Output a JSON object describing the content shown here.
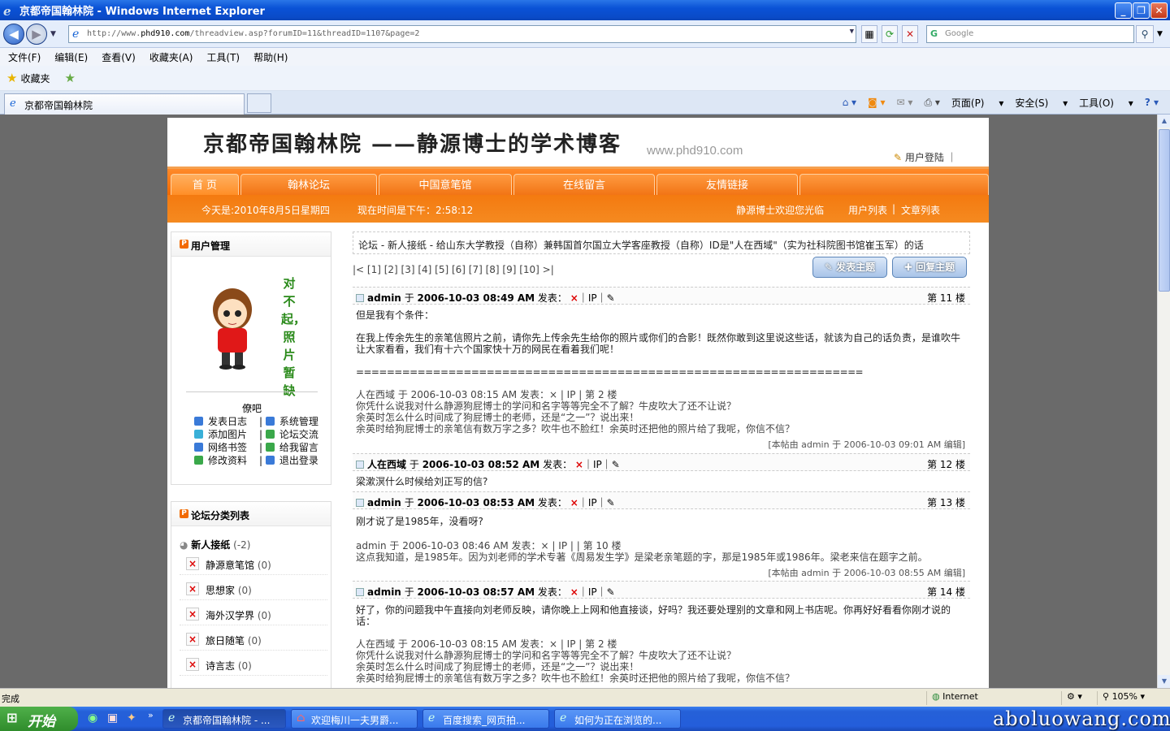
{
  "window": {
    "title": "京都帝国翰林院 - Windows Internet Explorer"
  },
  "address": {
    "url_prefix": "http://www.",
    "url_domain": "phd910.com",
    "url_path": "/threadview.asp?forumID=11&threadID=1107&page=2",
    "search_placeholder": "Google"
  },
  "menu": [
    "文件(F)",
    "编辑(E)",
    "查看(V)",
    "收藏夹(A)",
    "工具(T)",
    "帮助(H)"
  ],
  "favorites": {
    "label": "收藏夹"
  },
  "tab": {
    "title": "京都帝国翰林院"
  },
  "commandbar": {
    "page": "页面(P)",
    "safety": "安全(S)",
    "tools": "工具(O)"
  },
  "site": {
    "banner_title": "京都帝国翰林院 ——静源博士的学术博客",
    "banner_url": "www.phd910.com",
    "login": "用户登陆 ｜",
    "nav": [
      "首 页",
      "翰林论坛",
      "中国意笔馆",
      "在线留言",
      "友情链接"
    ],
    "date": "今天是:2010年8月5日星期四",
    "time": "现在时间是下午：2:58:12",
    "welcome": "静源博士欢迎您光临",
    "user_list": "用户列表",
    "article_list": "文章列表"
  },
  "sidebar": {
    "user_panel_title": "用户管理",
    "no_photo": "对不起，照片暂缺",
    "nickname": "僚吧",
    "links": [
      {
        "label": "发表日志",
        "color": "#3a7ad8"
      },
      {
        "label": "系统管理",
        "color": "#3a7ad8"
      },
      {
        "label": "添加图片",
        "color": "#3ab0d8"
      },
      {
        "label": "论坛交流",
        "color": "#3aa84a"
      },
      {
        "label": "网络书签",
        "color": "#3a7ad8"
      },
      {
        "label": "给我留言",
        "color": "#3aa84a"
      },
      {
        "label": "修改资料",
        "color": "#3aa84a"
      },
      {
        "label": "退出登录",
        "color": "#3a7ad8"
      }
    ],
    "forum_panel_title": "论坛分类列表",
    "forum_group": "新人接纸",
    "forum_group_count": "(-2)",
    "forums": [
      {
        "name": "静源意笔馆",
        "count": "(0)"
      },
      {
        "name": "思想家",
        "count": "(0)"
      },
      {
        "name": "海外汉学界",
        "count": "(0)"
      },
      {
        "name": "旅日随笔",
        "count": "(0)"
      },
      {
        "name": "诗言志",
        "count": "(0)"
      }
    ]
  },
  "main": {
    "breadcrumb": "论坛 - 新人接纸 - 给山东大学教授（自称）兼韩国首尔国立大学客座教授（自称）ID是\"人在西域\"（实为社科院图书馆崔玉军）的话",
    "pager": "|< [1] [2] [3] [4] [5] [6] [7] [8] [9] [10] >|",
    "btn_new": "发表主题",
    "btn_reply": "回复主题",
    "posts": [
      {
        "author": "admin",
        "yu": "于",
        "time": "2006-10-03 08:49 AM",
        "meta": "发表：",
        "x": "×",
        "ip": "｜IP｜",
        "floor": "第 11 楼",
        "lines": [
          "但是我有个条件：",
          "",
          "在我上传余先生的亲笔信照片之前，请你先上传余先生给你的照片或你们的合影！既然你敢到这里说这些话，就该为自己的话负责，是谁吹牛让大家看看，我们有十六个国家快十万的网民在看着我们呢！",
          "",
          "==================================================================",
          "",
          "人在西域 于 2006-10-03 08:15 AM 发表：× | IP |  第 2 楼",
          "你凭什么说我对什么静源狗屁博士的学问和名字等等完全不了解？牛皮吹大了还不让说？",
          "余英时怎么什么时间成了狗屁博士的老师，还是“之一”？说出来！",
          "余英时给狗屁博士的亲笔信有数万字之多？吹牛也不脸红！余英时还把他的照片给了我呢，你信不信？"
        ],
        "edit": "[本帖由 admin 于 2006-10-03 09:01 AM 编辑]"
      },
      {
        "author": "人在西域",
        "yu": "于",
        "time": "2006-10-03 08:52 AM",
        "meta": "发表：",
        "x": "×",
        "ip": "｜IP｜",
        "floor": "第 12 楼",
        "lines": [
          "梁漱溟什么时候给刘正写的信?"
        ]
      },
      {
        "author": "admin",
        "yu": "于",
        "time": "2006-10-03 08:53 AM",
        "meta": "发表：",
        "x": "×",
        "ip": "｜IP｜",
        "floor": "第 13 楼",
        "lines": [
          "刚才说了是1985年，没看呀?",
          "",
          " admin 于 2006-10-03 08:46 AM 发表：× | IP | |  第 10 楼",
          "这点我知道，是1985年。因为刘老师的学术专著《周易发生学》是梁老亲笔题的字，那是1985年或1986年。梁老来信在题字之前。"
        ],
        "edit": "[本帖由 admin 于 2006-10-03 08:55 AM 编辑]"
      },
      {
        "author": "admin",
        "yu": "于",
        "time": "2006-10-03 08:57 AM",
        "meta": "发表：",
        "x": "×",
        "ip": "｜IP｜",
        "floor": "第 14 楼",
        "lines": [
          "好了，你的问题我中午直接向刘老师反映，请你晚上上网和他直接谈，好吗？我还要处理别的文章和网上书店呢。你再好好看看你刚才说的话：",
          "",
          "人在西域 于 2006-10-03 08:15 AM 发表：× | IP |  第 2 楼",
          "你凭什么说我对什么静源狗屁博士的学问和名字等等完全不了解？牛皮吹大了还不让说？",
          "余英时怎么什么时间成了狗屁博士的老师，还是“之一”？说出来！",
          "余英时给狗屁博士的亲笔信有数万字之多？吹牛也不脸红！余英时还把他的照片给了我呢，你信不信？"
        ]
      }
    ]
  },
  "status": {
    "text": "完成",
    "zone": "Internet",
    "zoom": "105%"
  },
  "taskbar": {
    "start": "开始",
    "items": [
      "京都帝国翰林院 - ...",
      "欢迎梅川一夫男爵...",
      "百度搜索_网页拍...",
      "如何为正在浏览的..."
    ],
    "watermark": "aboluowang.com"
  }
}
